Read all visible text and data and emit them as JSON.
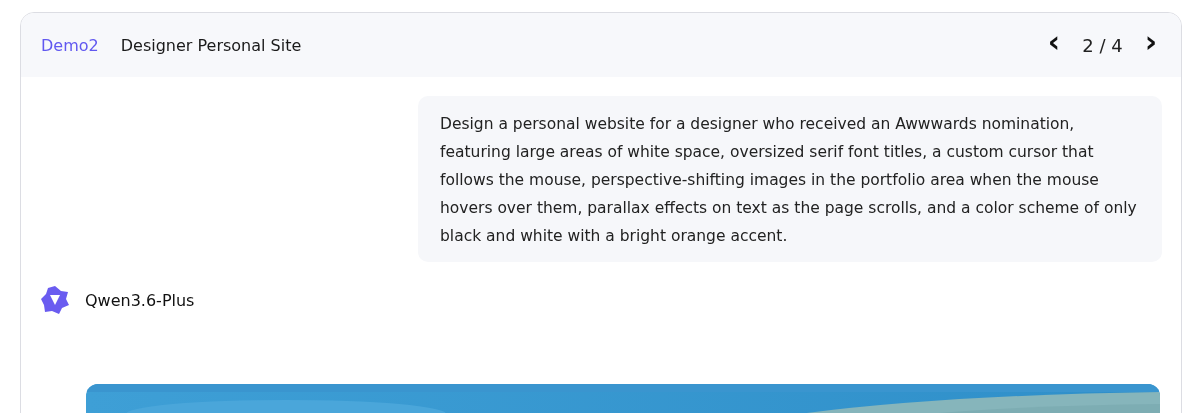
{
  "header": {
    "tag": "Demo2",
    "title": "Designer Personal Site",
    "prev": "‹",
    "page": "2 / 4",
    "next": "›"
  },
  "prompt": "Design a personal website for a designer who received an Awwwards nomination, featuring large areas of white space, oversized serif font titles, a custom cursor that follows the mouse, perspective-shifting images in the portfolio area when the mouse hovers over them, parallax effects on text as the page scrolls, and a color scheme of only black and white with a bright orange accent.",
  "model": {
    "name": "Qwen3.6-Plus"
  }
}
